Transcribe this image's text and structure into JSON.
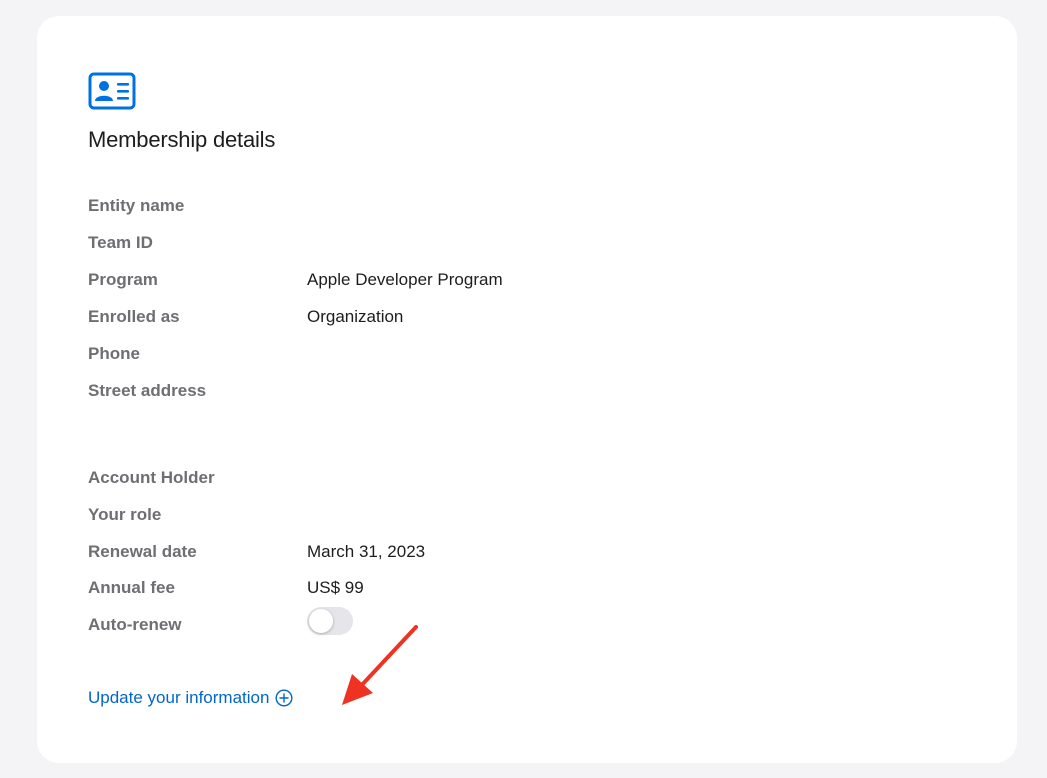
{
  "card": {
    "title": "Membership details",
    "icon": "id-card-icon"
  },
  "rows": [
    {
      "label": "Entity name",
      "value": ""
    },
    {
      "label": "Team ID",
      "value": ""
    },
    {
      "label": "Program",
      "value": "Apple Developer Program"
    },
    {
      "label": "Enrolled as",
      "value": "Organization"
    },
    {
      "label": "Phone",
      "value": ""
    },
    {
      "label": "Street address",
      "value": ""
    },
    {
      "label": "Account Holder",
      "value": ""
    },
    {
      "label": "Your role",
      "value": ""
    },
    {
      "label": "Renewal date",
      "value": "March 31, 2023"
    },
    {
      "label": "Annual fee",
      "value": "US$ 99"
    },
    {
      "label": "Auto-renew",
      "value": "",
      "toggle": {
        "enabled": false
      }
    }
  ],
  "update_link": {
    "label": "Update your information",
    "icon": "plus-circle-icon"
  },
  "annotation": {
    "icon": "red-arrow-icon",
    "color": "#ee3322"
  },
  "colors": {
    "accent": "#0066cc",
    "label_gray": "#6e6e73",
    "text": "#1d1d1f",
    "background": "#f4f4f6",
    "card": "#ffffff"
  }
}
